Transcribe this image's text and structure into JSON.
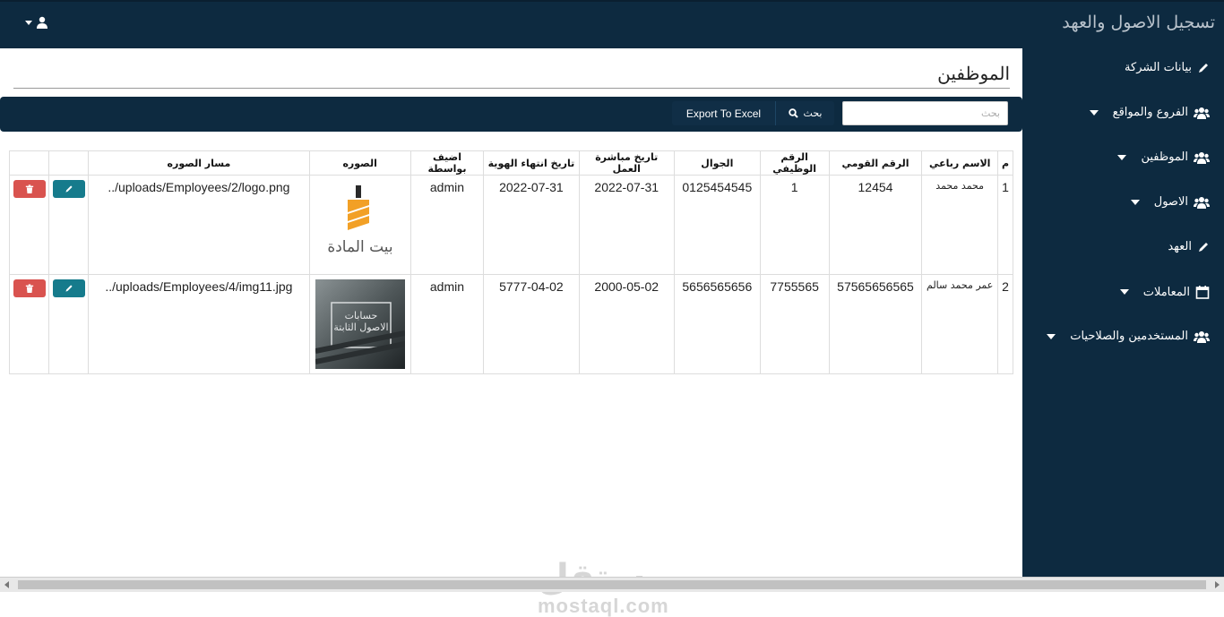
{
  "app": {
    "title": "تسجيل الاصول والعهد"
  },
  "sidebar": {
    "items": [
      {
        "label": "بيانات الشركة",
        "icon": "pencil-icon",
        "has_caret": false
      },
      {
        "label": "الفروع والمواقع",
        "icon": "users-icon",
        "has_caret": true
      },
      {
        "label": "الموظفين",
        "icon": "users-icon",
        "has_caret": true
      },
      {
        "label": "الاصول",
        "icon": "users-icon",
        "has_caret": true
      },
      {
        "label": "العهد",
        "icon": "pencil-icon",
        "has_caret": false
      },
      {
        "label": "المعاملات",
        "icon": "calendar-icon",
        "has_caret": true
      },
      {
        "label": "المستخدمين والصلاحيات",
        "icon": "users-icon",
        "has_caret": true
      }
    ]
  },
  "page": {
    "title": "الموظفين"
  },
  "toolbar": {
    "search_placeholder": "بحث",
    "search_button": "بحث",
    "export_button": "Export To Excel"
  },
  "table": {
    "headers": [
      "م",
      "الاسم رباعي",
      "الرقم القومي",
      "الرقم الوظيفي",
      "الجوال",
      "تاريخ مباشرة العمل",
      "تاريخ انتهاء الهوية",
      "اضيف بواسطة",
      "الصوره",
      "مسار الصوره",
      "",
      ""
    ],
    "rows": [
      {
        "index": "1",
        "name": "محمد محمد",
        "national_id": "12454",
        "job_no": "1",
        "mobile": "0125454545",
        "start_date": "2022-07-31",
        "id_expiry": "2022-07-31",
        "added_by": "admin",
        "image_text": "بيت المادة",
        "image_path": "uploads/Employees/2/logo.png/.."
      },
      {
        "index": "2",
        "name": "عمر محمد سالم",
        "national_id": "57565656565",
        "job_no": "7755565",
        "mobile": "5656565656",
        "start_date": "2000-05-02",
        "id_expiry": "5777-04-02",
        "added_by": "admin",
        "image_text": "حسابات الاصول الثابتة",
        "image_path": "uploads/Employees/4/img11.jpg/.."
      }
    ]
  },
  "watermark": {
    "arabic": "مستقل",
    "latin": "mostaql.com"
  },
  "colors": {
    "nav": "#0d2a40",
    "edit": "#167b8c",
    "delete": "#d9534f"
  }
}
